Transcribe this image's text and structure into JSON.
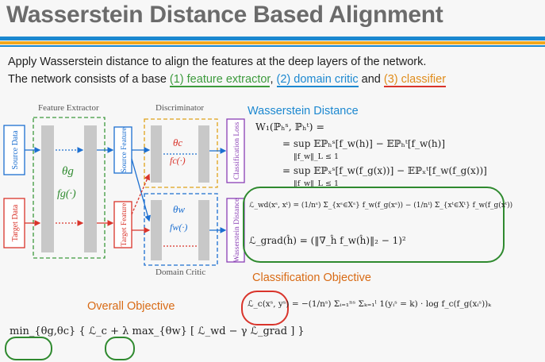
{
  "slide": {
    "title": "Wasserstein Distance Based Alignment",
    "intro_line1": "Apply Wasserstein distance to align the features at the deep layers of the network.",
    "intro_line2_prefix": "The network consists of a base ",
    "part1": "(1) feature extractor",
    "sep1": ", ",
    "part2": "(2) domain critic",
    "sep2": " and ",
    "part3": "(3) classifier",
    "colors": {
      "green": "#3c9a3c",
      "blue": "#1c88d0",
      "orange": "#e08c1a",
      "red": "#d9342b"
    }
  },
  "diagram": {
    "feature_extractor": "Feature Extractor",
    "discriminator": "Discriminator",
    "domain_critic": "Domain Critic",
    "source_data": "Source Data",
    "target_data": "Target Data",
    "source_feature": "Source Feature",
    "target_feature": "Target Feature",
    "classification_loss": "Classification Loss",
    "wasserstein_distance_box": "Wasserstein Distance",
    "theta_g": "θg",
    "f_g": "fg(·)",
    "theta_c": "θc",
    "f_c": "fc(·)",
    "theta_w": "θw",
    "f_w": "fw(·)"
  },
  "wasserstein": {
    "heading": "Wasserstein Distance",
    "eq1": "W₁(ℙₕˢ, ℙₕᵗ) =",
    "eq2": "= sup  𝔼ℙₕˢ[f_w(h)] − 𝔼ℙₕᵗ[f_w(h)]",
    "eq2_sub": "‖f_w‖_L ≤ 1",
    "eq3": "= sup  𝔼ℙₓˢ[f_w(f_g(x))] − 𝔼ℙₓᵗ[f_w(f_g(x))]",
    "eq3_sub": "‖f_w‖_L ≤ 1",
    "lwd": "ℒ_wd(xˢ, xᵗ) = (1/nˢ) Σ_{xˢ∈Xˢ} f_w(f_g(xˢ)) − (1/nᵗ) Σ_{xᵗ∈Xᵗ} f_w(f_g(xᵗ))",
    "lgrad": "ℒ_grad(ĥ) = (‖∇_ĥ f_w(ĥ)‖₂ − 1)²"
  },
  "classification": {
    "heading": "Classification Objective",
    "eq": "ℒ_c(xˢ, yˢ) = −(1/nˢ) Σᵢ₌₁ⁿˢ Σₖ₌₁ˡ 1(yᵢˢ = k) · log f_c(f_g(xᵢˢ))ₖ"
  },
  "overall": {
    "heading": "Overall Objective",
    "eq": "min_{θg,θc} { ℒ_c + λ max_{θw} [ ℒ_wd − γ ℒ_grad ] }"
  }
}
